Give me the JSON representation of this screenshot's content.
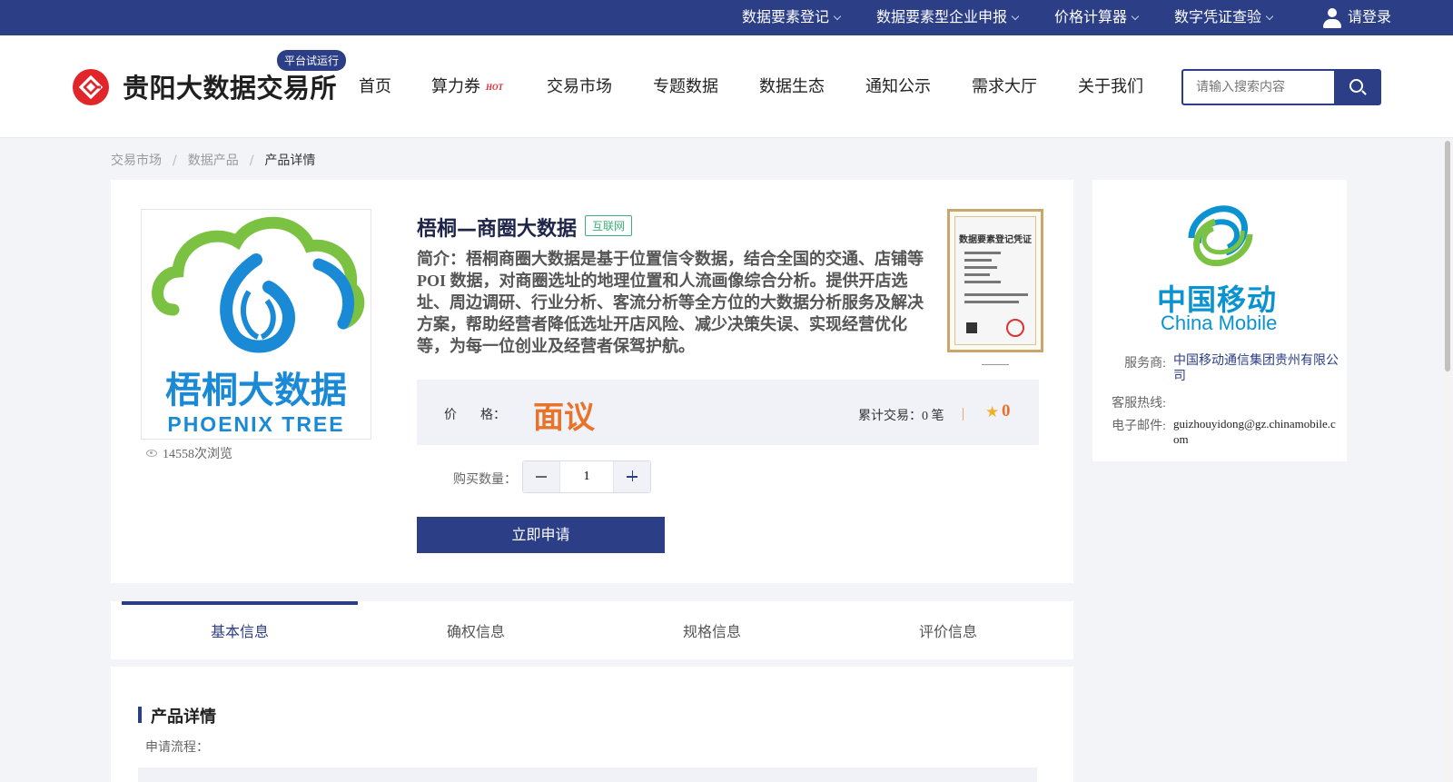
{
  "topbar": {
    "items": [
      {
        "label": "数据要素登记"
      },
      {
        "label": "数据要素型企业申报"
      },
      {
        "label": "价格计算器"
      },
      {
        "label": "数字凭证查验"
      }
    ],
    "login_label": "请登录"
  },
  "header": {
    "brand_name": "贵阳大数据交易所",
    "trial_badge": "平台试运行",
    "nav": [
      "首页",
      "算力券",
      "交易市场",
      "专题数据",
      "数据生态",
      "通知公示",
      "需求大厅",
      "关于我们"
    ],
    "hot_label": "HOT",
    "search_placeholder": "请输入搜索内容"
  },
  "breadcrumb": [
    "交易市场",
    "数据产品",
    "产品详情"
  ],
  "product": {
    "image_text_cn": "梧桐大数据",
    "image_text_en": "PHOENIX TREE",
    "views": "14558次浏览",
    "title": "梧桐—商圈大数据",
    "tag": "互联网",
    "intro": "简介：梧桐商圈大数据是基于位置信令数据，结合全国的交通、店铺等POI 数据，对商圈选址的地理位置和人流画像综合分析。提供开店选址、周边调研、行业分析、客流分析等全方位的大数据分析服务及解决方案，帮助经营者降低选址开店风险、减少决策失误、实现经营优化等，为每一位创业及经营者保驾护航。",
    "cert_title": "数据要素登记凭证",
    "price_label_a": "价",
    "price_label_b": "格：",
    "price_value": "面议",
    "trades": "累计交易：0 笔",
    "rating": "0",
    "qty_label": "购买数量：",
    "qty_value": "1",
    "apply_label": "立即申请"
  },
  "provider": {
    "logo_cn": "中国移动",
    "logo_en": "China Mobile",
    "service_key": "服务商:",
    "service_val": "中国移动通信集团贵州有限公司",
    "hotline_key": "客服热线:",
    "hotline_val": "",
    "email_key": "电子邮件:",
    "email_val": "guizhouyidong@gz.chinamobile.com"
  },
  "tabs": [
    "基本信息",
    "确权信息",
    "规格信息",
    "评价信息"
  ],
  "detail": {
    "title": "产品详情",
    "process_label": "申请流程："
  },
  "colors": {
    "brand": "#2b3e86",
    "price": "#e8732a",
    "logo_red": "#e0262b",
    "cm_blue": "#0a93d0"
  }
}
